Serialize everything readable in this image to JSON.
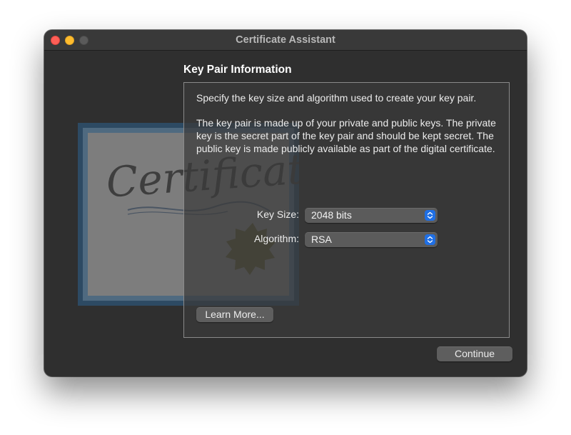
{
  "window": {
    "title": "Certificate Assistant"
  },
  "section": {
    "title": "Key Pair Information"
  },
  "description": {
    "line1": "Specify the key size and algorithm used to create your key pair.",
    "line2": "The key pair is made up of your private and public keys. The private key is the secret part of the key pair and should be kept secret. The public key is made publicly available as part of the digital certificate."
  },
  "form": {
    "key_size_label": "Key Size:",
    "key_size_value": "2048 bits",
    "algorithm_label": "Algorithm:",
    "algorithm_value": "RSA"
  },
  "buttons": {
    "learn_more": "Learn More...",
    "continue": "Continue"
  },
  "illustration": {
    "icon": "certificate-icon",
    "script_text": "Certificate"
  },
  "colors": {
    "close": "#ff5f57",
    "minimize": "#febc2e",
    "zoom_disabled": "#5a5a5a",
    "accent": "#1f6fe5",
    "window_bg": "#2f2f2f"
  }
}
